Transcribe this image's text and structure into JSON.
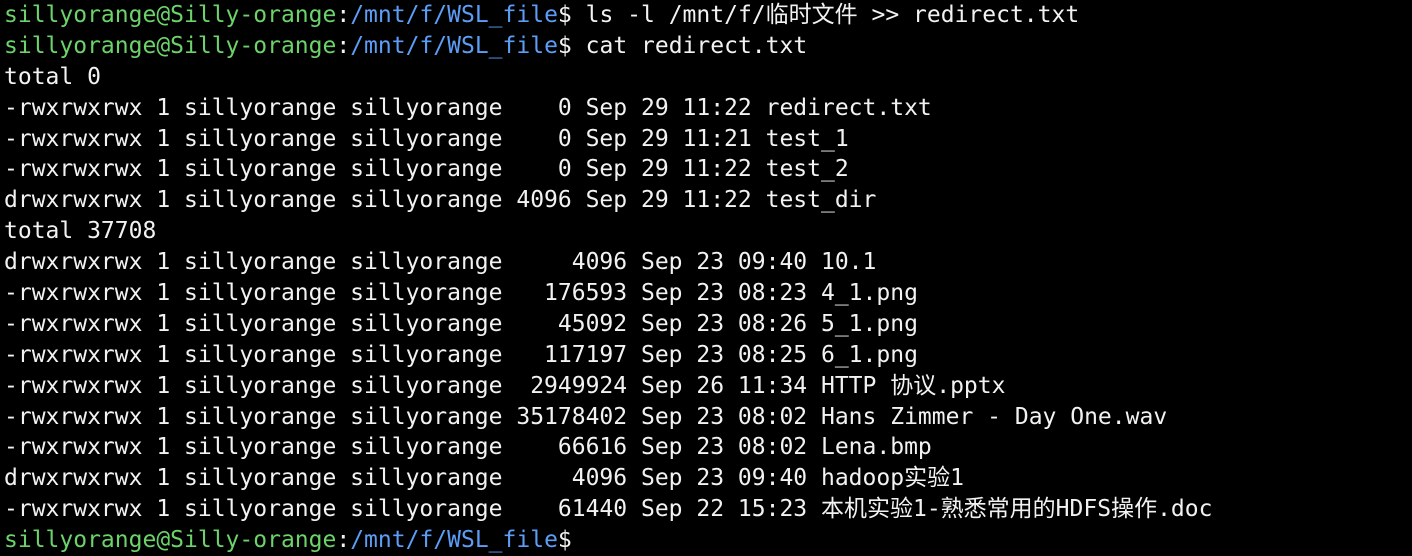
{
  "colors": {
    "background": "#000000",
    "text": "#f2f2f2",
    "prompt_user": "#6cd36a",
    "prompt_path": "#5c9ef7"
  },
  "prompt": {
    "user_host": "sillyorange@Silly-orange",
    "separator": ":",
    "path": "/mnt/f/WSL_file",
    "symbol": "$"
  },
  "lines": [
    {
      "type": "command",
      "text": " ls -l /mnt/f/临时文件 >> redirect.txt"
    },
    {
      "type": "command",
      "text": " cat redirect.txt"
    },
    {
      "type": "output",
      "text": "total 0"
    },
    {
      "type": "output",
      "text": "-rwxrwxrwx 1 sillyorange sillyorange    0 Sep 29 11:22 redirect.txt"
    },
    {
      "type": "output",
      "text": "-rwxrwxrwx 1 sillyorange sillyorange    0 Sep 29 11:21 test_1"
    },
    {
      "type": "output",
      "text": "-rwxrwxrwx 1 sillyorange sillyorange    0 Sep 29 11:22 test_2"
    },
    {
      "type": "output",
      "text": "drwxrwxrwx 1 sillyorange sillyorange 4096 Sep 29 11:22 test_dir"
    },
    {
      "type": "output",
      "text": "total 37708"
    },
    {
      "type": "output",
      "text": "drwxrwxrwx 1 sillyorange sillyorange     4096 Sep 23 09:40 10.1"
    },
    {
      "type": "output",
      "text": "-rwxrwxrwx 1 sillyorange sillyorange   176593 Sep 23 08:23 4_1.png"
    },
    {
      "type": "output",
      "text": "-rwxrwxrwx 1 sillyorange sillyorange    45092 Sep 23 08:26 5_1.png"
    },
    {
      "type": "output",
      "text": "-rwxrwxrwx 1 sillyorange sillyorange   117197 Sep 23 08:25 6_1.png"
    },
    {
      "type": "output",
      "text": "-rwxrwxrwx 1 sillyorange sillyorange  2949924 Sep 26 11:34 HTTP 协议.pptx"
    },
    {
      "type": "output",
      "text": "-rwxrwxrwx 1 sillyorange sillyorange 35178402 Sep 23 08:02 Hans Zimmer - Day One.wav"
    },
    {
      "type": "output",
      "text": "-rwxrwxrwx 1 sillyorange sillyorange    66616 Sep 23 08:02 Lena.bmp"
    },
    {
      "type": "output",
      "text": "drwxrwxrwx 1 sillyorange sillyorange     4096 Sep 23 09:40 hadoop实验1"
    },
    {
      "type": "output",
      "text": "-rwxrwxrwx 1 sillyorange sillyorange    61440 Sep 22 15:23 本机实验1-熟悉常用的HDFS操作.doc"
    },
    {
      "type": "command",
      "text": ""
    }
  ]
}
